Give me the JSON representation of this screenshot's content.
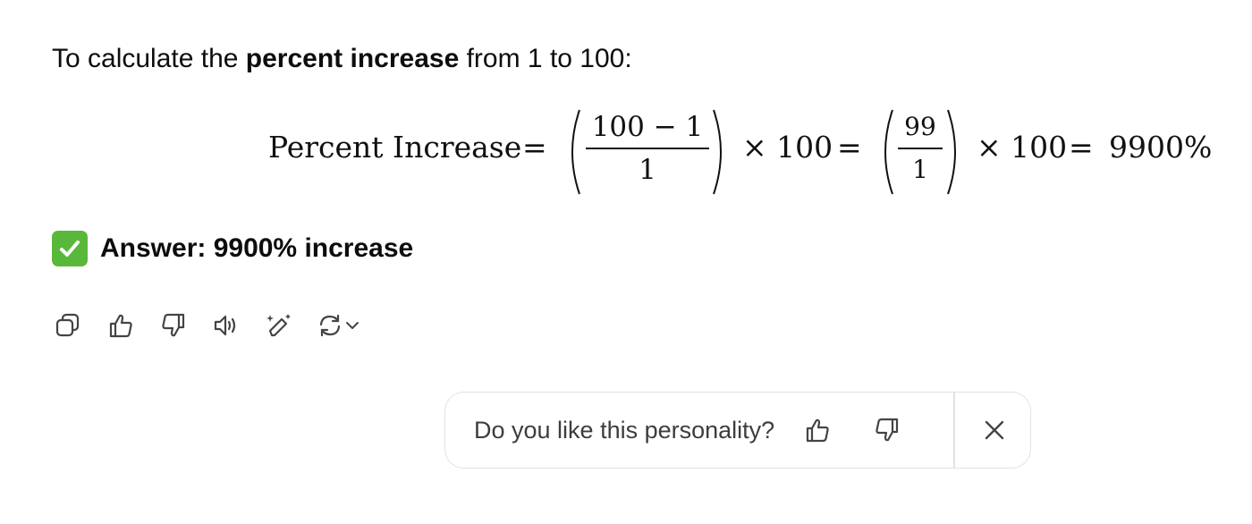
{
  "message": {
    "intro_prefix": "To calculate the ",
    "intro_bold": "percent increase",
    "intro_suffix": " from 1 to 100:",
    "formula": {
      "label": "Percent Increase",
      "equals": "=",
      "frac1_num": "100 − 1",
      "frac1_den": "1",
      "times1": "× 100",
      "frac2_num": "99",
      "frac2_den": "1",
      "times2": "× 100",
      "result": "9900%"
    },
    "answer_emoji_icon": "check-mark-button-icon",
    "answer_text": "Answer: 9900% increase"
  },
  "actions": [
    {
      "name": "copy",
      "icon": "copy-icon"
    },
    {
      "name": "thumbs-up",
      "icon": "thumbs-up-icon"
    },
    {
      "name": "thumbs-down",
      "icon": "thumbs-down-icon"
    },
    {
      "name": "read-aloud",
      "icon": "speaker-icon"
    },
    {
      "name": "edit",
      "icon": "pencil-sparkle-icon"
    },
    {
      "name": "regenerate",
      "icon": "refresh-icon"
    }
  ],
  "feedback": {
    "question": "Do you like this personality?",
    "icons": [
      "thumbs-up-icon",
      "thumbs-down-icon",
      "close-icon"
    ]
  },
  "colors": {
    "text": "#0d0d0d",
    "check_green": "#59b83a",
    "icon_gray": "#5d5d5d",
    "border": "#e2e2e2"
  }
}
